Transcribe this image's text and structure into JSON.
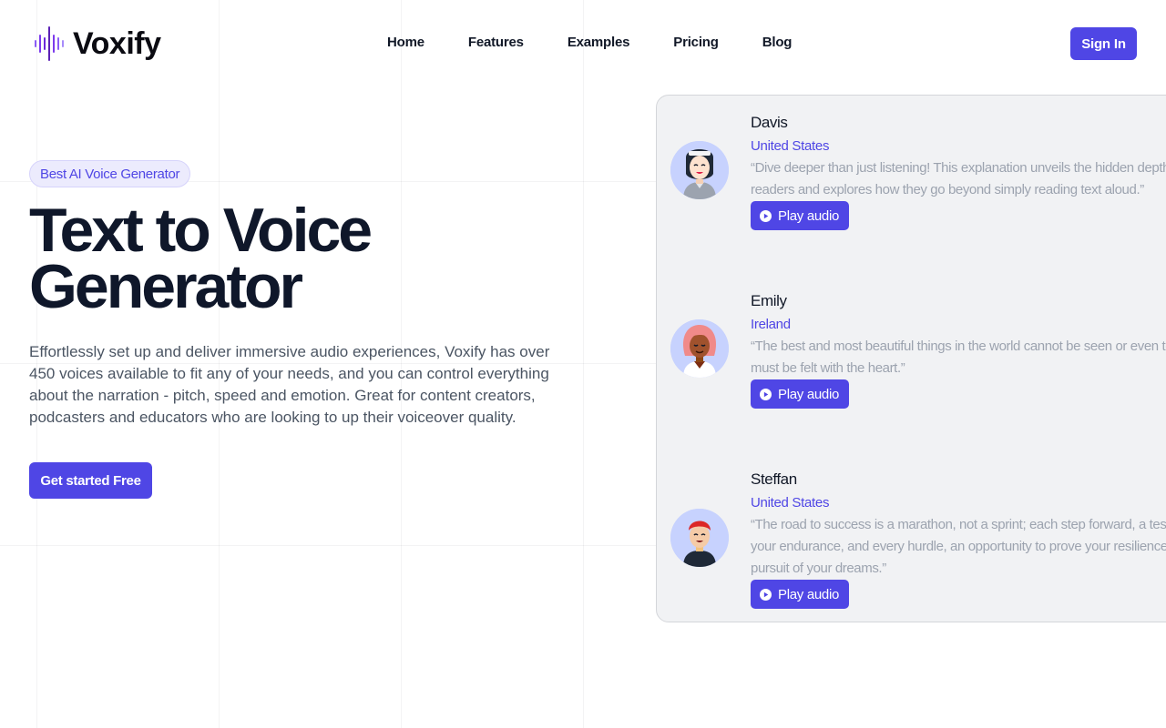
{
  "brand": {
    "name": "Voxify"
  },
  "nav": [
    {
      "label": "Home"
    },
    {
      "label": "Features"
    },
    {
      "label": "Examples"
    },
    {
      "label": "Pricing"
    },
    {
      "label": "Blog"
    }
  ],
  "header": {
    "signin_label": "Sign In"
  },
  "hero": {
    "badge": "Best AI Voice Generator",
    "title": "Text to Voice Generator",
    "description": "Effortlessly set up and deliver immersive audio experiences, Voxify has over 450 voices available to fit any of your needs, and you can control everything about the narration - pitch, speed and emotion. Great for content creators, podcasters and educators who are looking to up their voiceover quality.",
    "cta_label": "Get started Free"
  },
  "voices": [
    {
      "name": "Davis",
      "country": "United States",
      "quote_lines": [
        "“Dive deeper than just listening! This explanation unveils the hidden depths",
        "readers and explores how they go beyond simply reading text aloud.”"
      ],
      "play_label": "Play audio"
    },
    {
      "name": "Emily",
      "country": "Ireland",
      "quote_lines": [
        "“The best and most beautiful things in the world cannot be seen or even tou",
        "must be felt with the heart.”"
      ],
      "play_label": "Play audio"
    },
    {
      "name": "Steffan",
      "country": "United States",
      "quote_lines": [
        "“The road to success is a marathon, not a sprint; each step forward, a test",
        "your endurance, and every hurdle, an opportunity to prove your resilience i",
        "pursuit of your dreams.”"
      ],
      "play_label": "Play audio"
    }
  ],
  "colors": {
    "accent": "#4f46e5",
    "avatar_bg": "#c7d2fe",
    "panel_bg": "#f1f2f4",
    "muted_text": "#9ca3af"
  }
}
